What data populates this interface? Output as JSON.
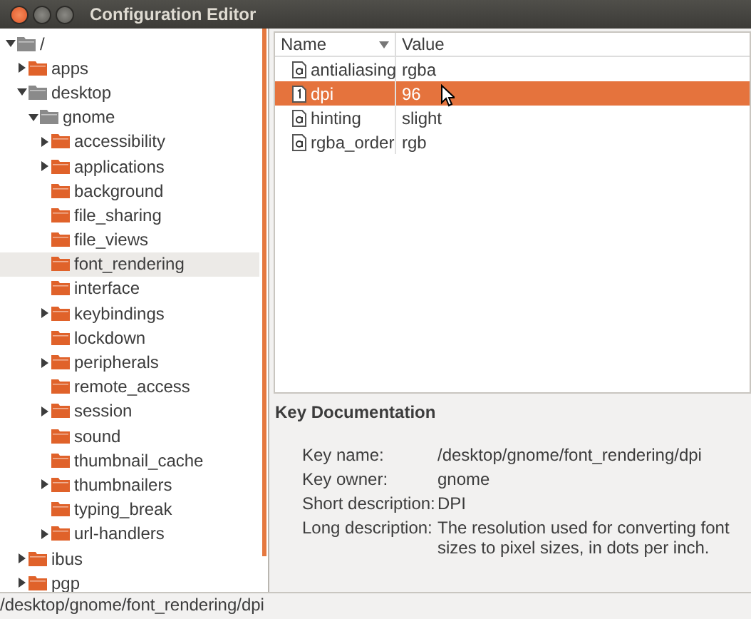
{
  "window": {
    "title": "Configuration Editor"
  },
  "tree": [
    {
      "label": "/",
      "expanded": true,
      "selected": false,
      "color": "#8a8a8a",
      "children": [
        {
          "label": "apps",
          "expanded": false,
          "selected": false,
          "color": "#e0622a"
        },
        {
          "label": "desktop",
          "expanded": true,
          "selected": false,
          "color": "#8a8a8a",
          "children": [
            {
              "label": "gnome",
              "expanded": true,
              "selected": false,
              "color": "#8a8a8a",
              "children": [
                {
                  "label": "accessibility",
                  "expanded": false,
                  "selected": false,
                  "color": "#e0622a"
                },
                {
                  "label": "applications",
                  "expanded": false,
                  "selected": false,
                  "color": "#e0622a"
                },
                {
                  "label": "background",
                  "selected": false,
                  "color": "#e0622a"
                },
                {
                  "label": "file_sharing",
                  "selected": false,
                  "color": "#e0622a"
                },
                {
                  "label": "file_views",
                  "selected": false,
                  "color": "#e0622a"
                },
                {
                  "label": "font_rendering",
                  "selected": true,
                  "color": "#e0622a"
                },
                {
                  "label": "interface",
                  "selected": false,
                  "color": "#e0622a"
                },
                {
                  "label": "keybindings",
                  "expanded": false,
                  "selected": false,
                  "color": "#e0622a"
                },
                {
                  "label": "lockdown",
                  "selected": false,
                  "color": "#e0622a"
                },
                {
                  "label": "peripherals",
                  "expanded": false,
                  "selected": false,
                  "color": "#e0622a"
                },
                {
                  "label": "remote_access",
                  "selected": false,
                  "color": "#e0622a"
                },
                {
                  "label": "session",
                  "expanded": false,
                  "selected": false,
                  "color": "#e0622a"
                },
                {
                  "label": "sound",
                  "selected": false,
                  "color": "#e0622a"
                },
                {
                  "label": "thumbnail_cache",
                  "selected": false,
                  "color": "#e0622a"
                },
                {
                  "label": "thumbnailers",
                  "expanded": false,
                  "selected": false,
                  "color": "#e0622a"
                },
                {
                  "label": "typing_break",
                  "selected": false,
                  "color": "#e0622a"
                },
                {
                  "label": "url-handlers",
                  "expanded": false,
                  "selected": false,
                  "color": "#e0622a"
                }
              ]
            }
          ]
        },
        {
          "label": "ibus",
          "expanded": false,
          "selected": false,
          "color": "#e0622a"
        },
        {
          "label": "pgp",
          "expanded": false,
          "selected": false,
          "color": "#e0622a"
        }
      ]
    }
  ],
  "table": {
    "columns": [
      "Name",
      "Value"
    ],
    "rows": [
      {
        "name": "antialiasing",
        "value": "rgba",
        "kind": "string",
        "selected": false
      },
      {
        "name": "dpi",
        "value": "96",
        "kind": "int",
        "selected": true
      },
      {
        "name": "hinting",
        "value": "slight",
        "kind": "string",
        "selected": false
      },
      {
        "name": "rgba_order",
        "value": "rgb",
        "kind": "string",
        "selected": false
      }
    ]
  },
  "documentation": {
    "title": "Key Documentation",
    "fields": [
      {
        "label": "Key name:",
        "value": "/desktop/gnome/font_rendering/dpi"
      },
      {
        "label": "Key owner:",
        "value": "gnome"
      },
      {
        "label": "Short description:",
        "value": "DPI"
      },
      {
        "label": "Long description:",
        "value": "The resolution used for converting font sizes to pixel sizes, in dots per inch."
      }
    ]
  },
  "status_bar": "/desktop/gnome/font_rendering/dpi"
}
